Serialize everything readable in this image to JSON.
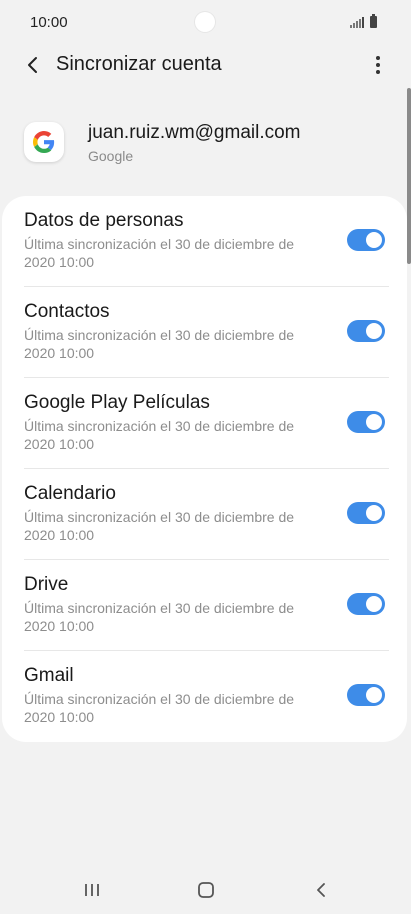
{
  "status_bar": {
    "time": "10:00",
    "icons": [
      "signal-icon",
      "battery-icon"
    ]
  },
  "header": {
    "title": "Sincronizar cuenta",
    "back_icon": "chevron-left-icon",
    "more_icon": "more-vertical-icon"
  },
  "account": {
    "email": "juan.ruiz.wm@gmail.com",
    "provider": "Google",
    "logo_icon": "google-logo-icon"
  },
  "sync_items": [
    {
      "label": "Datos de personas",
      "subtitle": "Última sincronización el 30 de diciembre de 2020 10:00",
      "enabled": true
    },
    {
      "label": "Contactos",
      "subtitle": "Última sincronización el 30 de diciembre de 2020 10:00",
      "enabled": true
    },
    {
      "label": "Google Play Películas",
      "subtitle": "Última sincronización el 30 de diciembre de 2020 10:00",
      "enabled": true
    },
    {
      "label": "Calendario",
      "subtitle": "Última sincronización el 30 de diciembre de 2020 10:00",
      "enabled": true
    },
    {
      "label": "Drive",
      "subtitle": "Última sincronización el 30 de diciembre de 2020 10:00",
      "enabled": true
    },
    {
      "label": "Gmail",
      "subtitle": "Última sincronización el 30 de diciembre de 2020 10:00",
      "enabled": true
    }
  ],
  "nav_bar": {
    "items": [
      "recents-icon",
      "home-icon",
      "back-icon"
    ]
  },
  "colors": {
    "accent": "#3e8ce8",
    "background": "#f2f2f2",
    "card": "#ffffff"
  }
}
